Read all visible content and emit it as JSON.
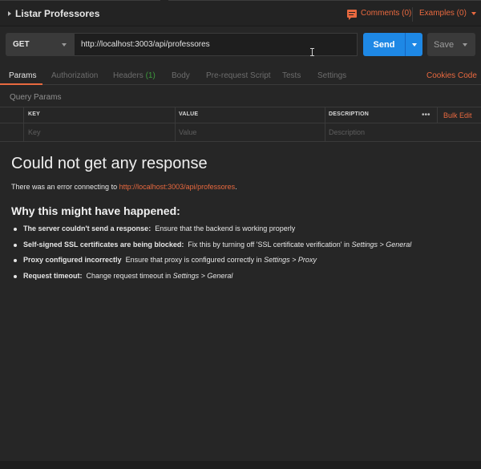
{
  "header": {
    "title": "Listar Professores",
    "comments_label": "Comments (0)",
    "examples_label": "Examples (0)"
  },
  "request": {
    "method": "GET",
    "url": "http://localhost:3003/api/professores",
    "send_label": "Send",
    "save_label": "Save"
  },
  "tabs": [
    {
      "label": "Params"
    },
    {
      "label": "Authorization"
    },
    {
      "label": "Headers",
      "count": "(1)"
    },
    {
      "label": "Body"
    },
    {
      "label": "Pre-request Script"
    },
    {
      "label": "Tests"
    },
    {
      "label": "Settings"
    }
  ],
  "tab_links": {
    "cookies": "Cookies",
    "code": "Code"
  },
  "query_params": {
    "label": "Query Params",
    "columns": [
      "KEY",
      "VALUE",
      "DESCRIPTION"
    ],
    "more": "•••",
    "bulk_edit": "Bulk Edit",
    "placeholders": {
      "key": "Key",
      "value": "Value",
      "description": "Description"
    }
  },
  "response": {
    "title": "Could not get any response",
    "error_prefix": "There was an error connecting to",
    "error_url": "http://localhost:3003/api/professores",
    "error_suffix": ".",
    "why_title": "Why this might have happened:",
    "reasons": [
      {
        "bold": "The server couldn't send a response:",
        "text": "Ensure that the backend is working properly"
      },
      {
        "bold": "Self-signed SSL certificates are being blocked:",
        "text": "Fix this by turning off 'SSL certificate verification' in",
        "italic": "Settings > General"
      },
      {
        "bold": "Proxy configured incorrectly",
        "text": "Ensure that proxy is configured correctly in",
        "italic": "Settings > Proxy"
      },
      {
        "bold": "Request timeout:",
        "text": "Change request timeout in",
        "italic": "Settings > General"
      }
    ]
  },
  "colors": {
    "accent": "#e9693f",
    "send": "#1e88e5",
    "background": "#262626"
  }
}
